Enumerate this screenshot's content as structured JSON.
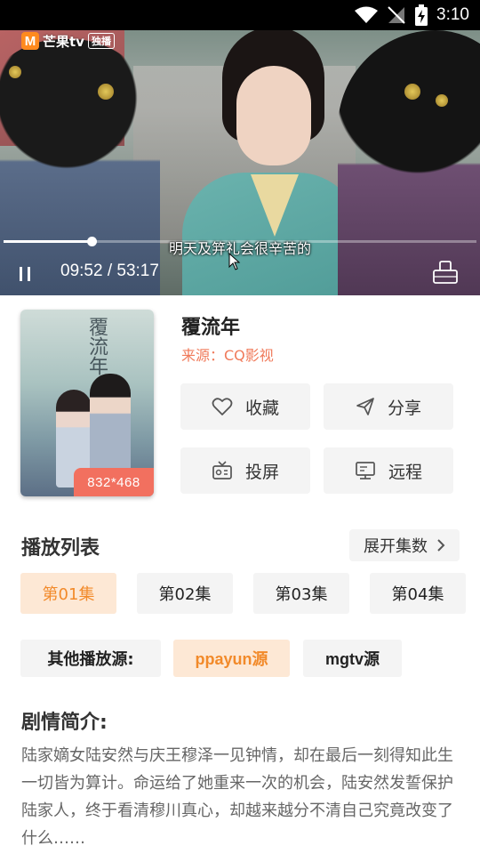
{
  "status_bar": {
    "time": "3:10"
  },
  "player": {
    "logo_text": "芒果tv",
    "logo_badge": "独播",
    "subtitle": "明天及笄礼会很辛苦的",
    "current_time": "09:52",
    "total_time": "53:17",
    "time_separator": " / ",
    "progress_fraction": 0.186
  },
  "show": {
    "title": "覆流年",
    "source": "来源：CQ影视",
    "poster_title": "覆流年",
    "resolution": "832*468"
  },
  "actions": {
    "favorite": "收藏",
    "share": "分享",
    "cast": "投屏",
    "remote": "远程"
  },
  "playlist": {
    "title": "播放列表",
    "expand_label": "展开集数",
    "episodes": [
      "第01集",
      "第02集",
      "第03集",
      "第04集"
    ],
    "active_episode_index": 0
  },
  "sources": {
    "label": "其他播放源:",
    "items": [
      "ppayun源",
      "mgtv源"
    ],
    "active_index": 0
  },
  "synopsis": {
    "title": "剧情简介:",
    "text": "陆家嫡女陆安然与庆王穆泽一见钟情，却在最后一刻得知此生一切皆为算计。命运给了她重来一次的机会，陆安然发誓保护陆家人，终于看清穆川真心，却越来越分不清自己究竟改变了什么……"
  },
  "colors": {
    "accent": "#f28a2a",
    "accent_bg": "#fde8d5",
    "source_text": "#f07a5a",
    "badge": "#f2705f"
  }
}
